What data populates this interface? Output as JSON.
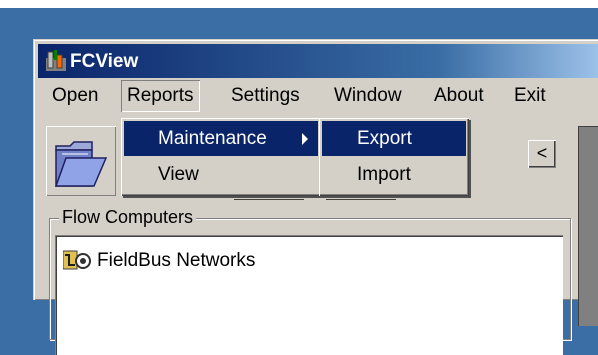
{
  "window": {
    "title": "FCView"
  },
  "menubar": {
    "items": [
      {
        "label": "Open"
      },
      {
        "label": "Reports"
      },
      {
        "label": "Settings"
      },
      {
        "label": "Window"
      },
      {
        "label": "About"
      },
      {
        "label": "Exit"
      }
    ]
  },
  "reports_menu": {
    "items": [
      {
        "label": "Maintenance",
        "highlighted": true,
        "has_submenu": true
      },
      {
        "label": "View"
      }
    ]
  },
  "maintenance_submenu": {
    "items": [
      {
        "label": "Export",
        "highlighted": true
      },
      {
        "label": "Import"
      }
    ]
  },
  "toolbar": {
    "scroll_left_label": "<"
  },
  "flow_computers": {
    "group_label": "Flow Computers",
    "items": [
      {
        "label": "FieldBus Networks",
        "icon": "network-icon"
      }
    ]
  },
  "colors": {
    "highlight": "#0a246a",
    "face": "#d4d0c8",
    "desktop": "#3a6ea5"
  }
}
